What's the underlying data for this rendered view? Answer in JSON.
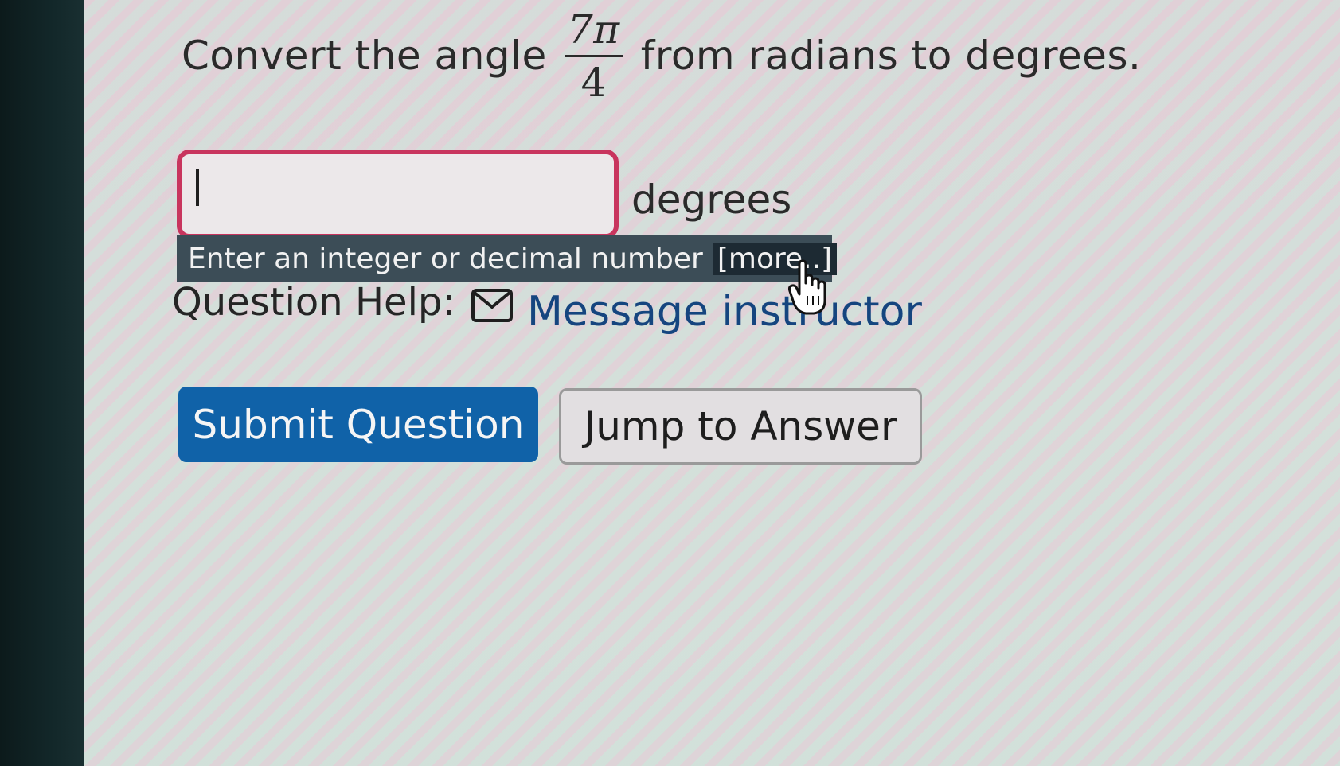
{
  "question": {
    "prefix": "Convert the angle",
    "fraction_numerator": "7π",
    "fraction_denominator": "4",
    "suffix": "from radians to degrees."
  },
  "answer": {
    "value": "",
    "unit": "degrees",
    "hint": "Enter an integer or decimal number",
    "more_link": "[more..]"
  },
  "help": {
    "label": "Question Help:",
    "message_link": "Message instructor",
    "icon": "envelope-icon"
  },
  "buttons": {
    "submit": "Submit Question",
    "jump": "Jump to Answer"
  },
  "colors": {
    "input_border": "#c8355e",
    "hint_bg": "#3c4d57",
    "link": "#15457f",
    "submit_bg": "#1062a8"
  }
}
